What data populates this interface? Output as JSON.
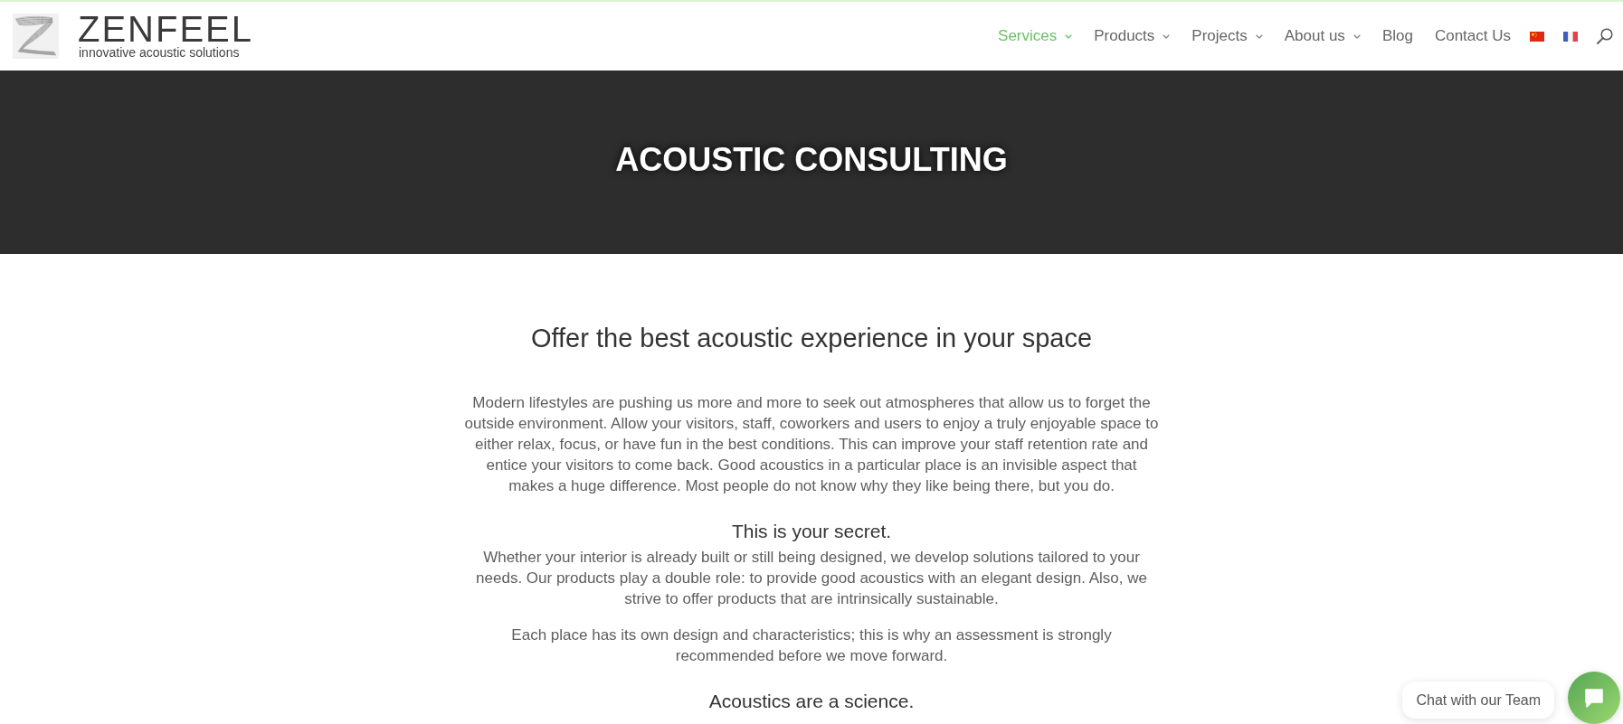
{
  "header": {
    "logo": {
      "wordmark": "ZENFEEL",
      "tagline": "innovative acoustic solutions"
    },
    "nav": [
      {
        "label": "Services",
        "selected": true,
        "dropdown": true
      },
      {
        "label": "Products",
        "selected": false,
        "dropdown": true
      },
      {
        "label": "Projects",
        "selected": false,
        "dropdown": true
      },
      {
        "label": "About us",
        "selected": false,
        "dropdown": true
      },
      {
        "label": "Blog",
        "selected": false,
        "dropdown": false
      },
      {
        "label": "Contact Us",
        "selected": false,
        "dropdown": false
      }
    ]
  },
  "hero": {
    "title": "ACOUSTIC CONSULTING"
  },
  "content": [
    {
      "kind": "title",
      "text": "Offer the best acoustic experience in your space"
    },
    {
      "kind": "paragraph",
      "text": "Modern lifestyles are pushing us more and more to seek out atmospheres that allow us to forget the outside environment. Allow your visitors, staff, coworkers and users to enjoy a truly enjoyable space to either relax, focus, or have fun in the best conditions. This can improve your staff retention rate and entice your visitors to come back. Good acoustics in a particular place is an invisible aspect that makes a huge difference. Most people do not know why they like being there, but you do."
    },
    {
      "kind": "heading",
      "text": "This is your secret."
    },
    {
      "kind": "paragraph",
      "text": "Whether your interior is already built or still being designed, we develop solutions tailored to your needs. Our products play a double role: to provide good acoustics with an elegant design. Also, we strive to offer products that are intrinsically sustainable."
    },
    {
      "kind": "paragraph",
      "text": "Each place has its own design and characteristics; this is why an assessment is strongly recommended before we move forward."
    },
    {
      "kind": "heading",
      "text": "Acoustics are a science."
    }
  ],
  "chat": {
    "label": "Chat with our Team"
  }
}
